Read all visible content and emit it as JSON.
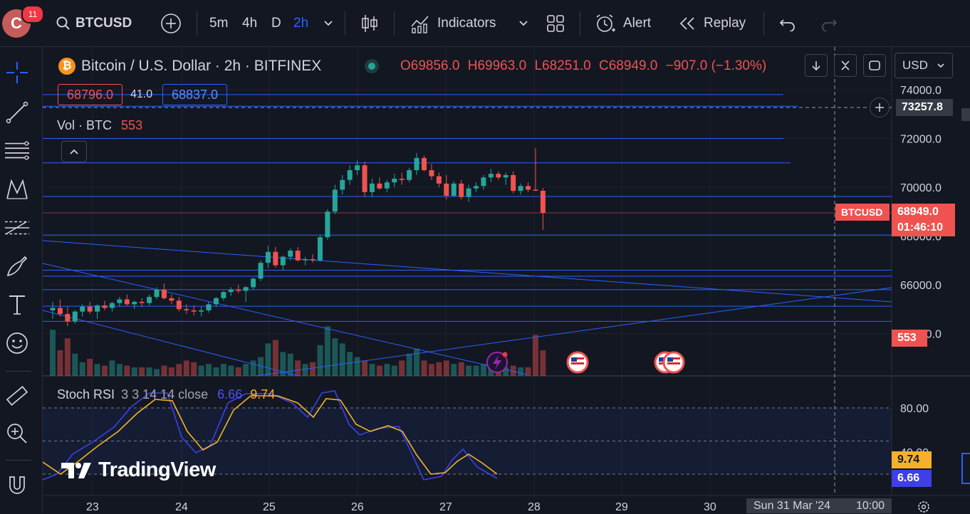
{
  "topbar": {
    "avatar_letter": "C",
    "notification_count": "11",
    "symbol": "BTCUSD",
    "intervals": [
      "5m",
      "4h",
      "D",
      "2h"
    ],
    "indicators_label": "Indicators",
    "alert_label": "Alert",
    "replay_label": "Replay"
  },
  "legend": {
    "title": "Bitcoin / U.S. Dollar · 2h · BITFINEX",
    "open": "O69856.0",
    "high": "H69963.0",
    "low": "L68251.0",
    "close": "C68949.0",
    "change": "−907.0 (−1.30%)",
    "bid": "68796.0",
    "spread": "41.0",
    "ask": "68837.0",
    "vol_label": "Vol · BTC",
    "vol_value": "553",
    "rsi_label": "Stoch RSI",
    "rsi_params": "3 3 14 14 close",
    "rsi_k": "6.66",
    "rsi_d": "9.74"
  },
  "currency": "USD",
  "price_axis": {
    "labels": [
      "74000.0",
      "72000.0",
      "70000.0",
      "68000.0",
      "66000.0",
      "64000.0"
    ],
    "crosshair_price": "73257.8",
    "last_price": "68949.0",
    "countdown": "01:46:10",
    "symbol_tag": "BTCUSD",
    "volume_tag": "553"
  },
  "rsi_axis": {
    "labels": [
      "80.00",
      "40.00"
    ],
    "d_tag": "9.74",
    "k_tag": "6.66"
  },
  "time_axis": {
    "labels": [
      "23",
      "24",
      "25",
      "26",
      "27",
      "28",
      "29",
      "30"
    ],
    "crosshair_time": "Sun 31 Mar '24",
    "crosshair_clock": "10:00"
  },
  "watermark": "TradingView",
  "colors": {
    "up": "#26a69a",
    "down": "#ef5350",
    "blue_line": "#2962ff",
    "rsi_k": "#3f3fe8",
    "rsi_d": "#f5b12a"
  },
  "chart_data": {
    "type": "candlestick",
    "title": "Bitcoin / U.S. Dollar · 2h · BITFINEX",
    "ylim": [
      63500,
      74500
    ],
    "x_ticks": [
      "23",
      "24",
      "25",
      "26",
      "27",
      "28",
      "29",
      "30"
    ],
    "candles": [
      [
        64950,
        65300,
        64600,
        65050
      ],
      [
        65050,
        65400,
        64700,
        64800
      ],
      [
        64800,
        65100,
        64300,
        64500
      ],
      [
        64500,
        64950,
        64400,
        64900
      ],
      [
        64900,
        65200,
        64700,
        65100
      ],
      [
        65100,
        65300,
        64800,
        64900
      ],
      [
        64900,
        65200,
        64600,
        65150
      ],
      [
        65150,
        65350,
        64950,
        65050
      ],
      [
        65050,
        65300,
        64900,
        65250
      ],
      [
        65250,
        65500,
        65100,
        65400
      ],
      [
        65400,
        65600,
        65150,
        65200
      ],
      [
        65200,
        65350,
        65000,
        65300
      ],
      [
        65300,
        65450,
        65100,
        65250
      ],
      [
        65250,
        65600,
        65150,
        65500
      ],
      [
        65500,
        65900,
        65400,
        65800
      ],
      [
        65800,
        66050,
        65400,
        65450
      ],
      [
        65450,
        65600,
        65200,
        65350
      ],
      [
        65350,
        65500,
        64900,
        65000
      ],
      [
        65000,
        65200,
        64800,
        64950
      ],
      [
        64950,
        65150,
        64750,
        64900
      ],
      [
        64900,
        65100,
        64700,
        64950
      ],
      [
        64950,
        65300,
        64850,
        65200
      ],
      [
        65200,
        65500,
        65100,
        65450
      ],
      [
        65450,
        65750,
        65350,
        65700
      ],
      [
        65700,
        65900,
        65550,
        65800
      ],
      [
        65800,
        66000,
        65650,
        65750
      ],
      [
        65750,
        65950,
        65300,
        65900
      ],
      [
        65900,
        66300,
        65800,
        66250
      ],
      [
        66250,
        67000,
        66150,
        66900
      ],
      [
        66900,
        67600,
        66700,
        67350
      ],
      [
        67350,
        67550,
        66700,
        66800
      ],
      [
        66800,
        67200,
        66600,
        67150
      ],
      [
        67150,
        67500,
        67000,
        67400
      ],
      [
        67400,
        67550,
        66950,
        67000
      ],
      [
        67000,
        67150,
        66800,
        67050
      ],
      [
        67050,
        67250,
        66900,
        67000
      ],
      [
        67000,
        68050,
        66950,
        67950
      ],
      [
        67950,
        69100,
        67850,
        69000
      ],
      [
        69000,
        70100,
        68900,
        69900
      ],
      [
        69900,
        70500,
        69700,
        70300
      ],
      [
        70300,
        70900,
        70100,
        70700
      ],
      [
        70700,
        71100,
        70500,
        70900
      ],
      [
        70900,
        71050,
        69600,
        69800
      ],
      [
        69800,
        70350,
        69600,
        70150
      ],
      [
        70150,
        70400,
        69900,
        69950
      ],
      [
        69950,
        70300,
        69800,
        70200
      ],
      [
        70200,
        70550,
        70000,
        70350
      ],
      [
        70350,
        70600,
        70100,
        70300
      ],
      [
        70300,
        70800,
        70200,
        70700
      ],
      [
        70700,
        71400,
        70500,
        71200
      ],
      [
        71200,
        71300,
        70650,
        70700
      ],
      [
        70700,
        70950,
        70300,
        70450
      ],
      [
        70450,
        70600,
        70000,
        70150
      ],
      [
        70150,
        70500,
        69500,
        69650
      ],
      [
        69650,
        70250,
        69600,
        70150
      ],
      [
        70150,
        70300,
        69500,
        69600
      ],
      [
        69600,
        70100,
        69400,
        69950
      ],
      [
        69950,
        70200,
        69800,
        70050
      ],
      [
        70050,
        70500,
        69900,
        70400
      ],
      [
        70400,
        70750,
        70200,
        70550
      ],
      [
        70550,
        70650,
        70300,
        70400
      ],
      [
        70400,
        70600,
        70100,
        70500
      ],
      [
        70500,
        70650,
        69750,
        69850
      ],
      [
        69850,
        70150,
        69700,
        70050
      ],
      [
        70050,
        70200,
        69800,
        69900
      ],
      [
        69900,
        71600,
        69850,
        69856
      ],
      [
        69856,
        69963,
        68251,
        68949
      ]
    ],
    "volume_max": 5000,
    "stoch_rsi": {
      "k": [
        6.66
      ],
      "d": [
        9.74
      ],
      "levels": [
        80,
        20
      ]
    }
  }
}
